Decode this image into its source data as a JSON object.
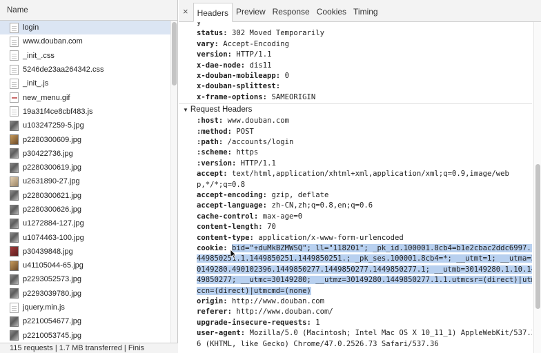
{
  "left": {
    "column_header": "Name",
    "files": [
      {
        "name": "login",
        "icon": "doc-icon"
      },
      {
        "name": "www.douban.com",
        "icon": "doc-icon"
      },
      {
        "name": "_init_.css",
        "icon": "doc-icon"
      },
      {
        "name": "5246de23aa264342.css",
        "icon": "doc-icon"
      },
      {
        "name": "_init_.js",
        "icon": "doc-icon"
      },
      {
        "name": "new_menu.gif",
        "icon": "gif-icon"
      },
      {
        "name": "19a31f4ce8cbf483.js",
        "icon": "doc-icon"
      },
      {
        "name": "u103247259-5.jpg",
        "icon": "image-icon"
      },
      {
        "name": "p2280300609.jpg",
        "icon": "image-icon"
      },
      {
        "name": "p30422736.jpg",
        "icon": "image-icon"
      },
      {
        "name": "p2280300619.jpg",
        "icon": "image-icon"
      },
      {
        "name": "u2631890-27.jpg",
        "icon": "image-icon"
      },
      {
        "name": "p2280300621.jpg",
        "icon": "image-icon"
      },
      {
        "name": "p2280300626.jpg",
        "icon": "image-icon"
      },
      {
        "name": "u1272884-127.jpg",
        "icon": "image-icon"
      },
      {
        "name": "u1074463-100.jpg",
        "icon": "image-icon"
      },
      {
        "name": "p30439848.jpg",
        "icon": "image-icon"
      },
      {
        "name": "u41105044-65.jpg",
        "icon": "image-icon"
      },
      {
        "name": "p2293052573.jpg",
        "icon": "image-icon"
      },
      {
        "name": "p2293039780.jpg",
        "icon": "image-icon"
      },
      {
        "name": "jquery.min.js",
        "icon": "doc-icon"
      },
      {
        "name": "p2210054677.jpg",
        "icon": "image-icon"
      },
      {
        "name": "p2210053745.jpg",
        "icon": "image-icon"
      }
    ],
    "status": "115 requests | 1.7 MB transferred | Finis"
  },
  "tabs": {
    "close": "×",
    "items": [
      "Headers",
      "Preview",
      "Response",
      "Cookies",
      "Timing"
    ]
  },
  "response_headers": [
    {
      "name": "",
      "value": "y"
    },
    {
      "name": "status:",
      "value": "302 Moved Temporarily"
    },
    {
      "name": "vary:",
      "value": "Accept-Encoding"
    },
    {
      "name": "version:",
      "value": "HTTP/1.1"
    },
    {
      "name": "x-dae-node:",
      "value": "dis11"
    },
    {
      "name": "x-douban-mobileapp:",
      "value": "0"
    },
    {
      "name": "x-douban-splittest:",
      "value": ""
    },
    {
      "name": "x-frame-options:",
      "value": "SAMEORIGIN"
    }
  ],
  "request_section_title": "Request Headers",
  "request_headers": [
    {
      "name": ":host:",
      "value": "www.douban.com"
    },
    {
      "name": ":method:",
      "value": "POST"
    },
    {
      "name": ":path:",
      "value": "/accounts/login"
    },
    {
      "name": ":scheme:",
      "value": "https"
    },
    {
      "name": ":version:",
      "value": "HTTP/1.1"
    },
    {
      "name": "accept:",
      "value": "text/html,application/xhtml+xml,application/xml;q=0.9,image/web"
    },
    {
      "name": "",
      "value": "p,*/*;q=0.8"
    },
    {
      "name": "accept-encoding:",
      "value": "gzip, deflate"
    },
    {
      "name": "accept-language:",
      "value": "zh-CN,zh;q=0.8,en;q=0.6"
    },
    {
      "name": "cache-control:",
      "value": "max-age=0"
    },
    {
      "name": "content-length:",
      "value": "70"
    },
    {
      "name": "content-type:",
      "value": "application/x-www-form-urlencoded"
    }
  ],
  "cookie": {
    "name": "cookie:",
    "lines": [
      "bid=\"+duMkBZMWSQ\"; ll=\"118201\"; _pk_id.100001.8cb4=b1e2cbac2ddc6997.1",
      "449850251.1.1449850251.1449850251.; _pk_ses.100001.8cb4=*; __utmt=1; __utma=3",
      "0149280.490102396.1449850277.1449850277.1449850277.1; __utmb=30149280.1.10.14",
      "49850277; __utmc=30149280; __utmz=30149280.1449850277.1.1.utmcsr=(direct)|utm",
      "ccn=(direct)|utmcmd=(none)"
    ]
  },
  "request_headers_tail": [
    {
      "name": "origin:",
      "value": "http://www.douban.com"
    },
    {
      "name": "referer:",
      "value": "http://www.douban.com/"
    },
    {
      "name": "upgrade-insecure-requests:",
      "value": "1"
    },
    {
      "name": "user-agent:",
      "value": "Mozilla/5.0 (Macintosh; Intel Mac OS X 10_11_1) AppleWebKit/537.3"
    },
    {
      "name": "",
      "value": "6 (KHTML, like Gecko) Chrome/47.0.2526.73 Safari/537.36"
    }
  ]
}
